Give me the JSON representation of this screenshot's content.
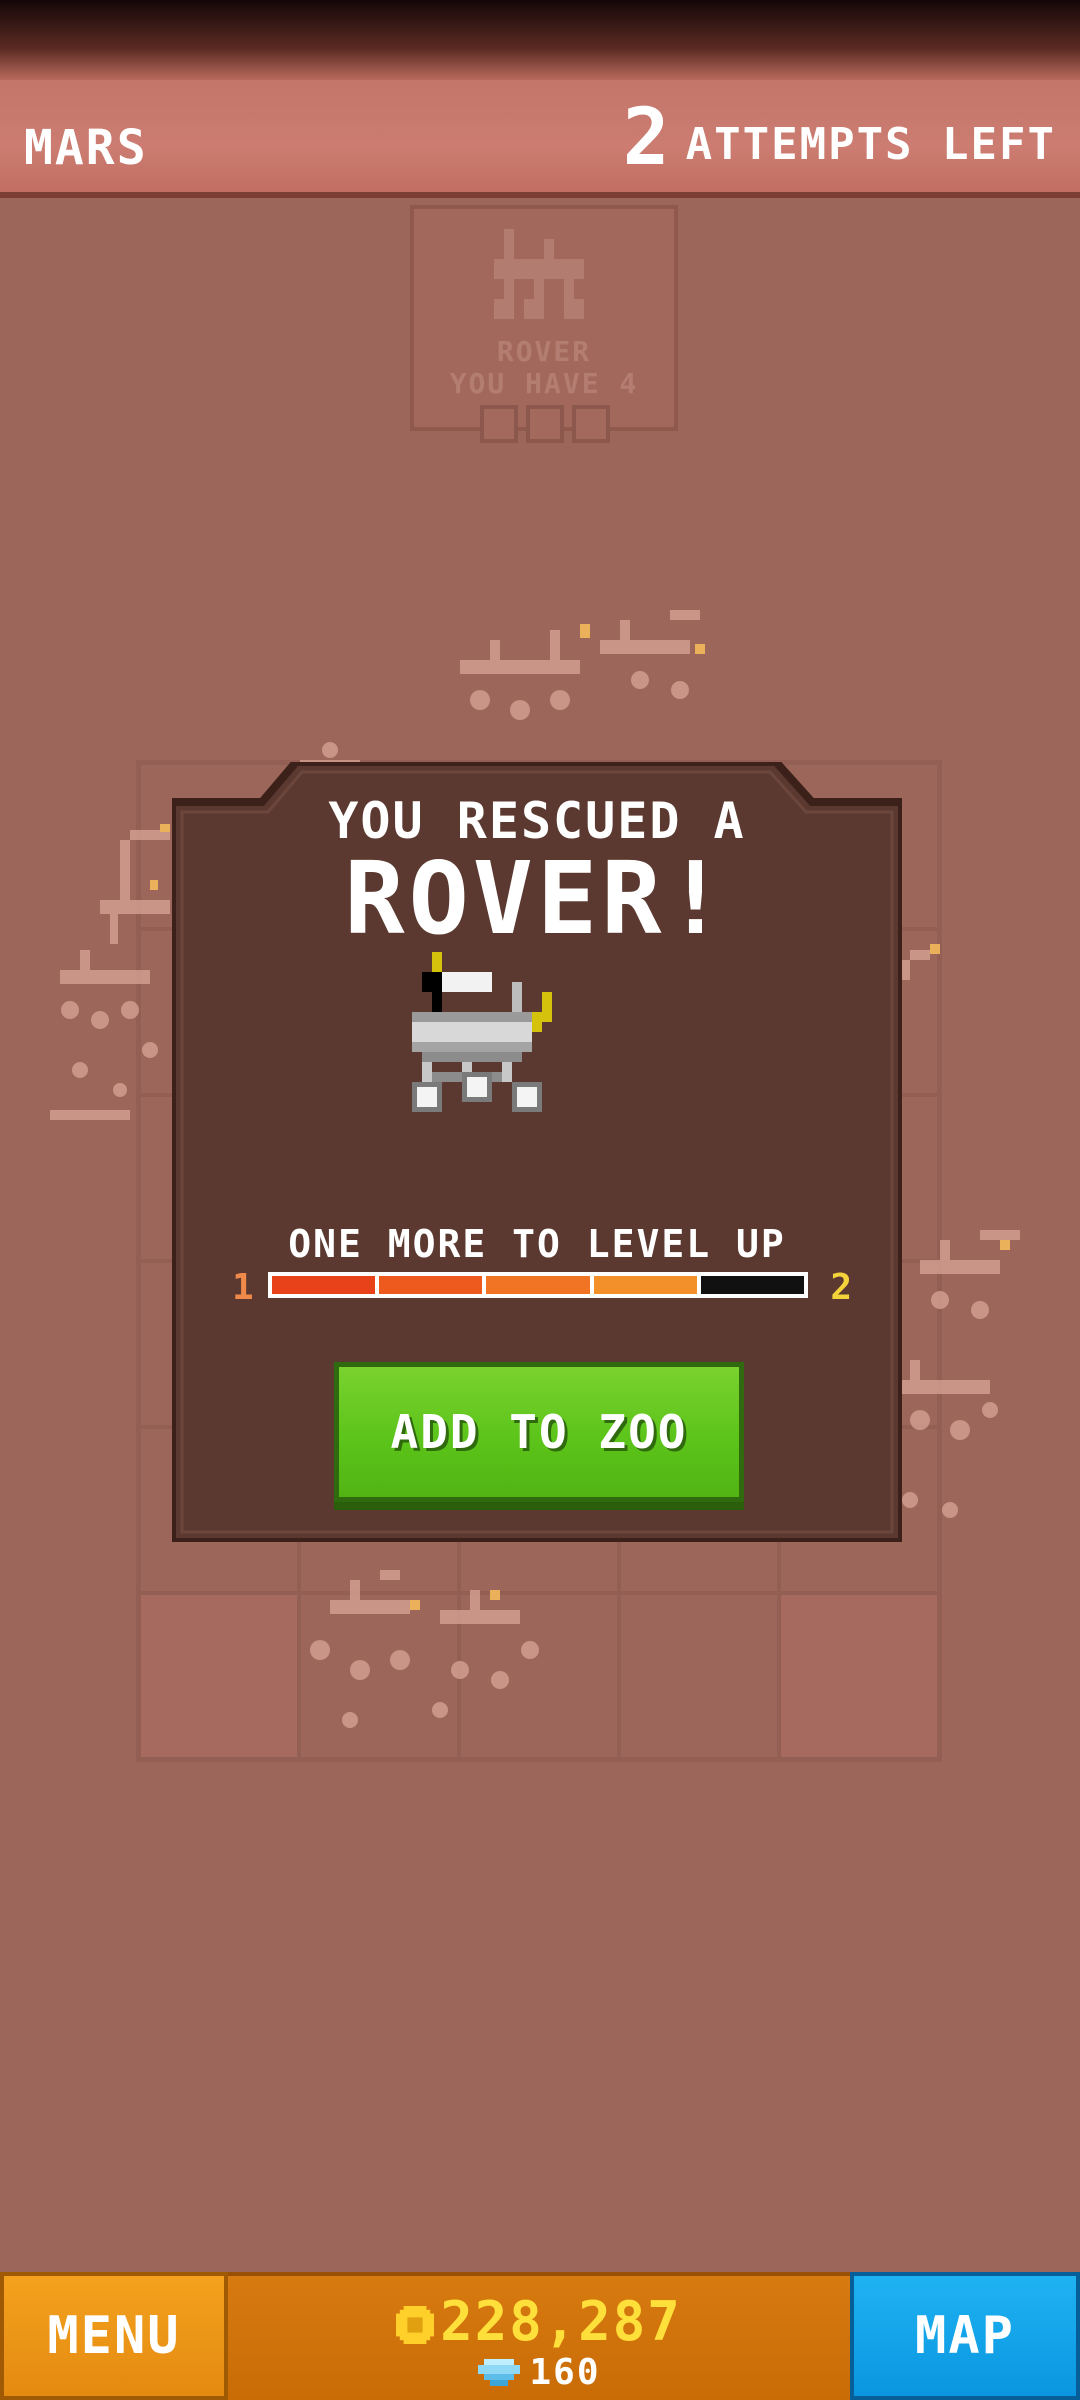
{
  "header": {
    "level_name": "MARS",
    "attempts_count": "2",
    "attempts_label": "ATTEMPTS LEFT"
  },
  "ghost_card": {
    "name": "ROVER",
    "subtitle": "YOU HAVE 4"
  },
  "modal": {
    "title_small": "YOU RESCUED A",
    "title_big": "ROVER!",
    "level_text": "ONE MORE TO LEVEL UP",
    "level_from": "1",
    "level_to": "2",
    "progress": {
      "filled": 4,
      "total": 5,
      "colors": [
        "#e8421a",
        "#ee5a1e",
        "#f07424",
        "#f4902a"
      ]
    },
    "button_label": "ADD TO ZOO"
  },
  "footer": {
    "menu_label": "MENU",
    "coins": "228,287",
    "gems": "160",
    "map_label": "MAP"
  },
  "icons": {
    "coin": "coin-icon",
    "gem": "diamond-icon"
  }
}
